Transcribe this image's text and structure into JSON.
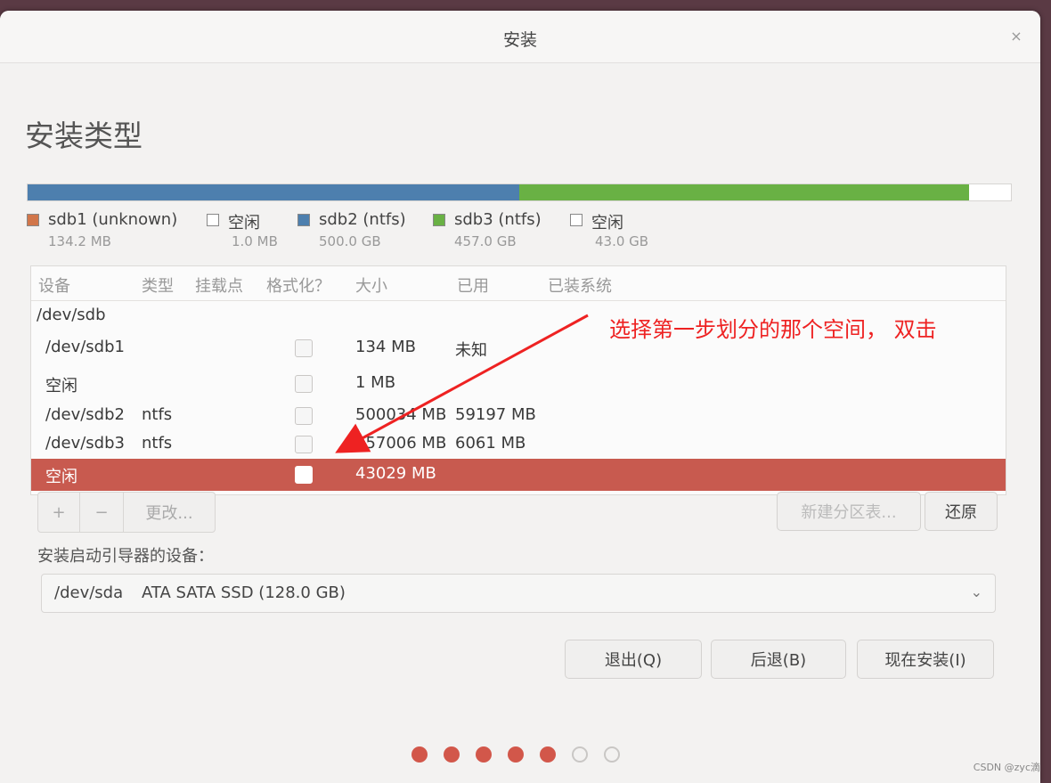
{
  "window": {
    "title": "安装",
    "close_glyph": "×"
  },
  "page": {
    "heading": "安装类型"
  },
  "partition_bar": {
    "segments": [
      {
        "name": "sdb1",
        "color": "#d1764a",
        "share": 0.0002
      },
      {
        "name": "free1",
        "color": "#ffffff",
        "share": 1e-05
      },
      {
        "name": "sdb2",
        "color": "#4d7fae",
        "share": 0.5
      },
      {
        "name": "free_mid",
        "color": "#ffffff",
        "share": 1e-05
      },
      {
        "name": "sdb3",
        "color": "#69b144",
        "share": 0.457
      },
      {
        "name": "free2",
        "color": "#ffffff",
        "share": 0.043
      }
    ]
  },
  "legend": [
    {
      "name": "sdb1 (unknown)",
      "size": "134.2 MB",
      "color": "#d1764a"
    },
    {
      "name": "空闲",
      "size": "1.0 MB",
      "color": "#ffffff"
    },
    {
      "name": "sdb2 (ntfs)",
      "size": "500.0 GB",
      "color": "#4d7fae"
    },
    {
      "name": "sdb3 (ntfs)",
      "size": "457.0 GB",
      "color": "#69b144"
    },
    {
      "name": "空闲",
      "size": "43.0 GB",
      "color": "#ffffff"
    }
  ],
  "table": {
    "headers": [
      "设备",
      "类型",
      "挂载点",
      "格式化？",
      "大小",
      "已用",
      "已装系统"
    ],
    "group": "/dev/sdb",
    "rows": [
      {
        "device": "/dev/sdb1",
        "type": "",
        "mount": "",
        "size": "134 MB",
        "used": "未知",
        "system": "",
        "selected": false
      },
      {
        "device": "空闲",
        "type": "",
        "mount": "",
        "size": "1 MB",
        "used": "",
        "system": "",
        "selected": false
      },
      {
        "device": "/dev/sdb2",
        "type": "ntfs",
        "mount": "",
        "size": "500034 MB",
        "used": "59197 MB",
        "system": "",
        "selected": false
      },
      {
        "device": "/dev/sdb3",
        "type": "ntfs",
        "mount": "",
        "size": "457006 MB",
        "used": "6061 MB",
        "system": "",
        "selected": false
      },
      {
        "device": "空闲",
        "type": "",
        "mount": "",
        "size": "43029 MB",
        "used": "",
        "system": "",
        "selected": true
      }
    ]
  },
  "annotation": {
    "text": "选择第一步划分的那个空间， 双击",
    "color": "#ee2222"
  },
  "toolbar": {
    "add": "+",
    "remove": "−",
    "change": "更改..."
  },
  "buttons": {
    "new_table": "新建分区表...",
    "revert": "还原",
    "quit": "退出(Q)",
    "back": "后退(B)",
    "install": "现在安装(I)"
  },
  "bootloader": {
    "label": "安装启动引导器的设备：",
    "device": "/dev/sda",
    "description": "ATA SATA SSD (128.0 GB)"
  },
  "progress": {
    "total": 7,
    "completed": 5
  },
  "watermark": "CSDN @zyc滴"
}
